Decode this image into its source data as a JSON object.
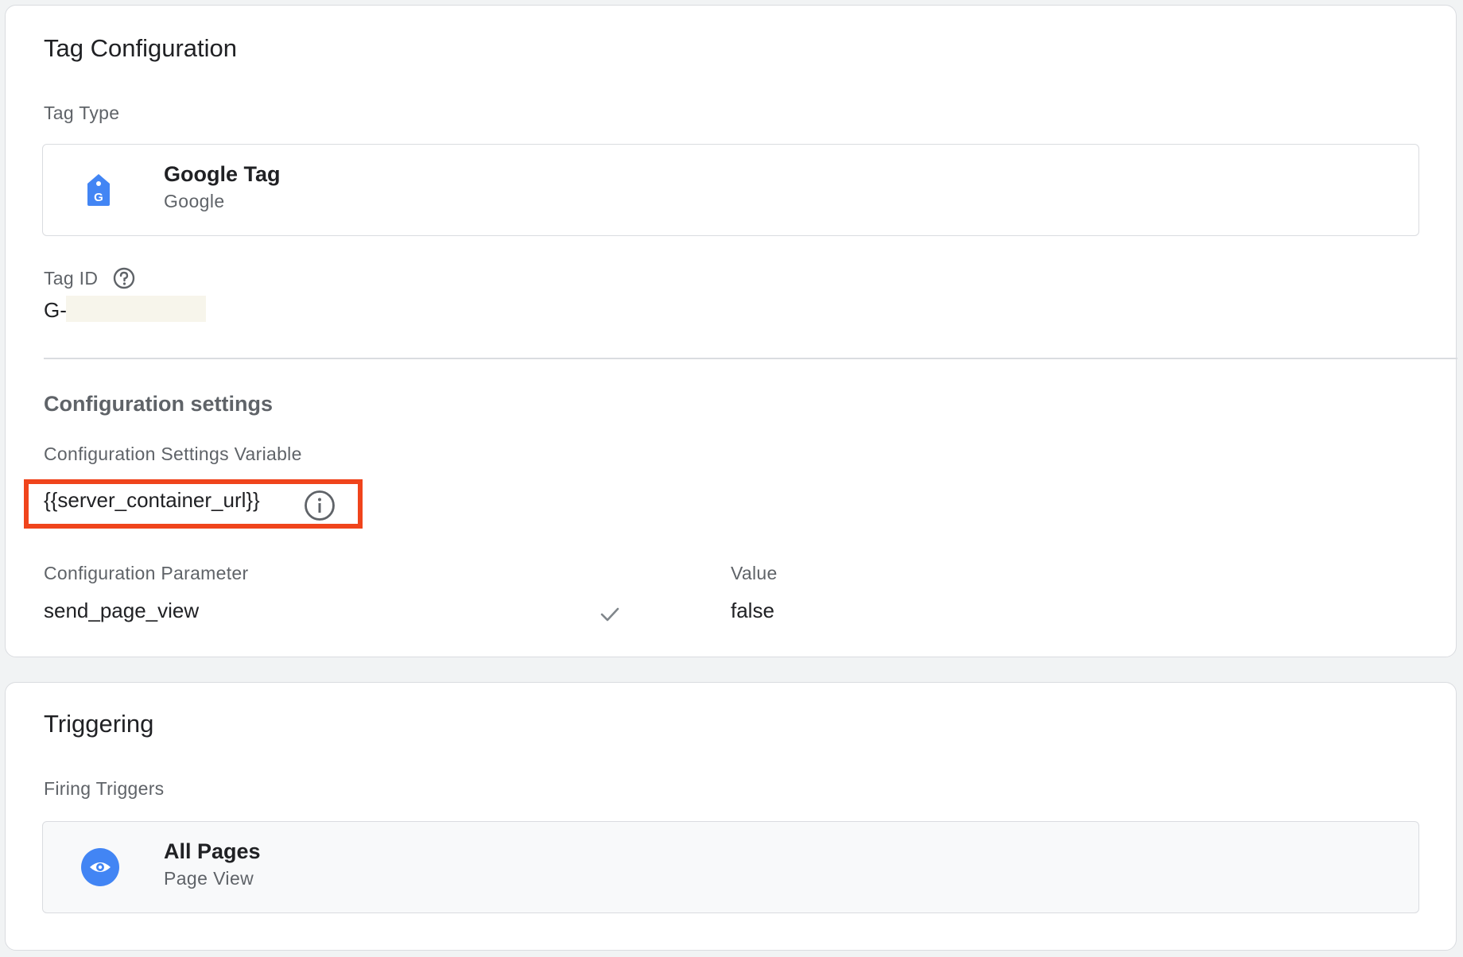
{
  "tag_configuration": {
    "title": "Tag Configuration",
    "tag_type_label": "Tag Type",
    "tag_type": {
      "name": "Google Tag",
      "vendor": "Google",
      "icon": "google-tag-icon",
      "icon_color": "#4285f4"
    },
    "tag_id": {
      "label": "Tag ID",
      "help_icon": "help-circle-icon",
      "value_prefix": "G-"
    },
    "configuration_settings": {
      "heading": "Configuration settings",
      "variable_label": "Configuration Settings Variable",
      "variable_value": "{{server_container_url}}",
      "info_icon": "info-icon",
      "highlight_color": "#f0441c"
    },
    "parameters": {
      "param_header": "Configuration Parameter",
      "value_header": "Value",
      "rows": [
        {
          "parameter": "send_page_view",
          "status_icon": "check-icon",
          "value": "false"
        }
      ]
    }
  },
  "triggering": {
    "title": "Triggering",
    "firing_triggers_label": "Firing Triggers",
    "trigger": {
      "name": "All Pages",
      "type": "Page View",
      "icon": "eye-icon",
      "icon_color": "#4285f4"
    }
  }
}
